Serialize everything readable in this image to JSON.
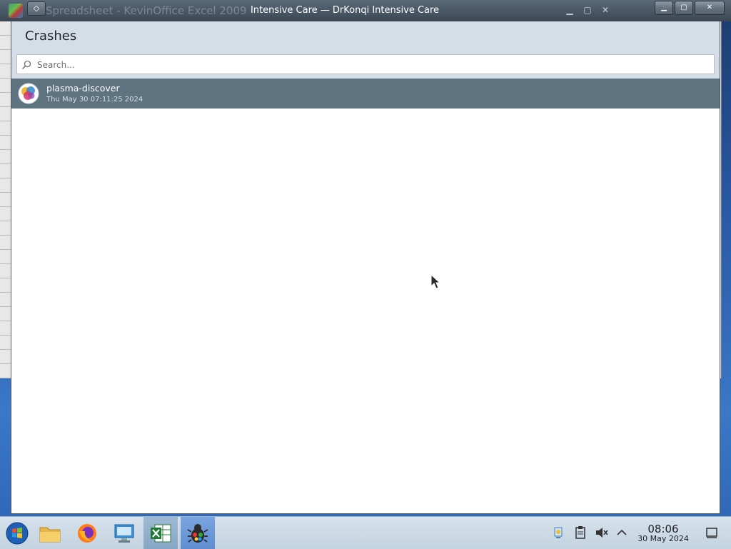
{
  "background_window": {
    "title": "Spreadsheet - KevinOffice Excel 2009"
  },
  "window": {
    "title": "Intensive Care — DrKonqi Intensive Care",
    "heading": "Crashes"
  },
  "search": {
    "placeholder": "Search...",
    "value": ""
  },
  "crashes": [
    {
      "name": "plasma-discover",
      "date": "Thu May 30 07:11:25 2024",
      "icon": "plasma-discover-icon"
    }
  ],
  "taskbar": {
    "items": [
      {
        "name": "start-menu",
        "icon": "windows-orb-icon"
      },
      {
        "name": "file-manager",
        "icon": "folder-icon"
      },
      {
        "name": "firefox",
        "icon": "firefox-icon"
      },
      {
        "name": "system-settings",
        "icon": "computer-icon"
      },
      {
        "name": "excel",
        "icon": "excel-icon"
      },
      {
        "name": "drkonqi",
        "icon": "bug-icon"
      }
    ],
    "clock_time": "08:06",
    "clock_date": "30 May 2024"
  },
  "colors": {
    "selected_row": "#5e7380",
    "header_bg": "#d5dee6",
    "titlebar": "#4a5866"
  }
}
